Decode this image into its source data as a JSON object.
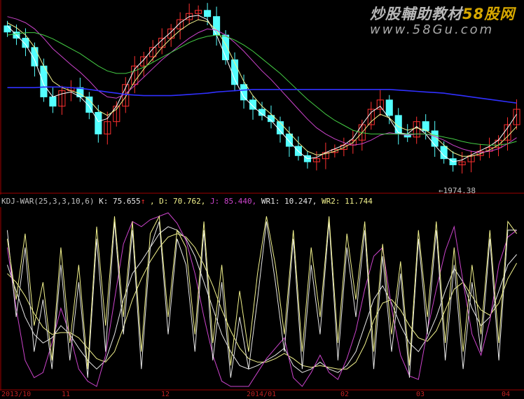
{
  "watermark": {
    "title_a": "炒股輔助教材",
    "title_b": "58股网",
    "url": "www.58Gu.com"
  },
  "price_panel": {
    "low_arrow": "←",
    "low_value": "1974.38"
  },
  "indicator": {
    "name": "KDJ-WAR(25,3,3,10,6)",
    "k_text": " K: 75.655",
    "k_arrow": "↑",
    "d_text": ", D: 70.762,",
    "j_text": " J: 85.440,",
    "wr1_text": " WR1: 10.247,",
    "wr2_text": " WR2: 11.744"
  },
  "colors": {
    "background": "#000000",
    "up_candle": "#ff3030",
    "down_candle": "#54ffff",
    "ma_white": "#ffffff",
    "ma_yellow": "#f2f28c",
    "ma_magenta": "#cc44cc",
    "ma_green": "#44cc44",
    "ma_blue": "#3030ff",
    "k_line": "#e8e8e8",
    "d_line": "#f2f28c",
    "j_line": "#cc44cc",
    "divider": "#a00000"
  },
  "chart_data": [
    {
      "type": "candlestick",
      "panel": "price",
      "low_annotation": 1974.38,
      "closes": [
        2205,
        2195,
        2180,
        2150,
        2100,
        2085,
        2110,
        2115,
        2100,
        2075,
        2040,
        2060,
        2085,
        2120,
        2150,
        2165,
        2180,
        2195,
        2210,
        2225,
        2235,
        2240,
        2230,
        2200,
        2160,
        2120,
        2095,
        2080,
        2070,
        2060,
        2040,
        2020,
        2005,
        1995,
        2000,
        2010,
        2015,
        2022,
        2030,
        2055,
        2080,
        2095,
        2070,
        2040,
        2035,
        2060,
        2045,
        2020,
        2000,
        1990,
        1995,
        2005,
        2012,
        2018,
        2030,
        2055,
        2080
      ],
      "moving_averages": [
        {
          "name": "MA5",
          "color": "#ffffff",
          "values": [
            2215,
            2200,
            2185,
            2160,
            2120,
            2100,
            2105,
            2108,
            2100,
            2085,
            2060,
            2065,
            2085,
            2115,
            2145,
            2160,
            2178,
            2192,
            2205,
            2220,
            2230,
            2232,
            2225,
            2200,
            2165,
            2128,
            2100,
            2085,
            2072,
            2062,
            2045,
            2028,
            2012,
            2000,
            2002,
            2010,
            2016,
            2022,
            2033,
            2055,
            2075,
            2085,
            2065,
            2042,
            2040,
            2052,
            2040,
            2022,
            2005,
            1995,
            1998,
            2006,
            2013,
            2020,
            2030,
            2050,
            2072
          ]
        },
        {
          "name": "MA10",
          "color": "#f2f28c",
          "values": [
            2220,
            2212,
            2200,
            2180,
            2150,
            2125,
            2115,
            2110,
            2105,
            2095,
            2078,
            2070,
            2080,
            2100,
            2125,
            2145,
            2162,
            2180,
            2195,
            2208,
            2218,
            2225,
            2222,
            2208,
            2185,
            2155,
            2125,
            2102,
            2085,
            2072,
            2058,
            2042,
            2026,
            2012,
            2006,
            2008,
            2012,
            2018,
            2026,
            2042,
            2060,
            2072,
            2066,
            2052,
            2046,
            2050,
            2046,
            2036,
            2022,
            2010,
            2004,
            2004,
            2008,
            2014,
            2022,
            2036,
            2052
          ]
        },
        {
          "name": "MA20",
          "color": "#cc44cc",
          "values": [
            2230,
            2226,
            2220,
            2210,
            2195,
            2178,
            2165,
            2152,
            2140,
            2126,
            2110,
            2100,
            2098,
            2105,
            2118,
            2132,
            2146,
            2160,
            2172,
            2184,
            2195,
            2204,
            2210,
            2208,
            2200,
            2188,
            2174,
            2158,
            2142,
            2128,
            2112,
            2096,
            2080,
            2064,
            2050,
            2040,
            2032,
            2026,
            2022,
            2024,
            2030,
            2038,
            2042,
            2040,
            2038,
            2040,
            2040,
            2036,
            2030,
            2022,
            2016,
            2012,
            2010,
            2012,
            2016,
            2024,
            2034
          ]
        },
        {
          "name": "MA30",
          "color": "#44cc44",
          "values": [
            2200,
            2202,
            2204,
            2204,
            2200,
            2194,
            2186,
            2178,
            2170,
            2160,
            2150,
            2142,
            2138,
            2138,
            2142,
            2148,
            2156,
            2164,
            2172,
            2180,
            2188,
            2194,
            2198,
            2200,
            2198,
            2192,
            2184,
            2174,
            2162,
            2150,
            2138,
            2124,
            2110,
            2096,
            2084,
            2072,
            2062,
            2054,
            2046,
            2042,
            2040,
            2040,
            2040,
            2040,
            2040,
            2040,
            2040,
            2038,
            2035,
            2032,
            2028,
            2025,
            2023,
            2022,
            2022,
            2024,
            2028
          ]
        },
        {
          "name": "MA60",
          "color": "#3030ff",
          "values": [
            2115,
            2115,
            2115,
            2115,
            2116,
            2116,
            2116,
            2115,
            2114,
            2112,
            2110,
            2108,
            2106,
            2104,
            2103,
            2102,
            2102,
            2102,
            2102,
            2103,
            2104,
            2105,
            2106,
            2108,
            2109,
            2110,
            2111,
            2112,
            2112,
            2112,
            2112,
            2112,
            2112,
            2112,
            2112,
            2112,
            2112,
            2112,
            2112,
            2112,
            2112,
            2112,
            2112,
            2111,
            2110,
            2109,
            2108,
            2107,
            2106,
            2104,
            2102,
            2100,
            2098,
            2096,
            2094,
            2092,
            2090
          ]
        }
      ]
    },
    {
      "type": "line",
      "panel": "indicator",
      "ylim": [
        0,
        100
      ],
      "series": [
        {
          "name": "K",
          "color": "#e8e8e8",
          "values": [
            70,
            55,
            40,
            30,
            25,
            28,
            35,
            30,
            22,
            15,
            10,
            15,
            30,
            50,
            65,
            72,
            80,
            88,
            92,
            90,
            85,
            75,
            60,
            45,
            30,
            20,
            12,
            10,
            12,
            15,
            18,
            22,
            12,
            8,
            10,
            14,
            10,
            8,
            12,
            20,
            35,
            50,
            58,
            48,
            35,
            25,
            20,
            28,
            40,
            55,
            68,
            60,
            45,
            35,
            40,
            55,
            70,
            76
          ]
        },
        {
          "name": "D",
          "color": "#f2f28c",
          "values": [
            65,
            60,
            52,
            42,
            34,
            30,
            31,
            31,
            28,
            22,
            16,
            14,
            20,
            34,
            50,
            62,
            72,
            80,
            86,
            88,
            86,
            80,
            70,
            58,
            44,
            32,
            22,
            16,
            14,
            14,
            16,
            19,
            16,
            12,
            11,
            12,
            11,
            10,
            10,
            14,
            24,
            38,
            48,
            50,
            44,
            35,
            28,
            26,
            32,
            44,
            56,
            60,
            52,
            44,
            41,
            48,
            62,
            71
          ]
        },
        {
          "name": "J",
          "color": "#cc44cc",
          "values": [
            80,
            45,
            15,
            5,
            8,
            25,
            45,
            30,
            10,
            3,
            0,
            18,
            50,
            82,
            95,
            92,
            96,
            98,
            100,
            94,
            84,
            65,
            40,
            18,
            3,
            0,
            0,
            0,
            8,
            16,
            22,
            28,
            5,
            0,
            8,
            18,
            8,
            4,
            16,
            32,
            56,
            75,
            80,
            45,
            18,
            6,
            4,
            32,
            56,
            78,
            92,
            60,
            30,
            18,
            38,
            70,
            86,
            90
          ]
        },
        {
          "name": "WR1",
          "color": "#e8e8e8",
          "values": [
            90,
            40,
            80,
            20,
            50,
            10,
            70,
            15,
            60,
            5,
            85,
            20,
            95,
            30,
            90,
            10,
            80,
            95,
            30,
            85,
            70,
            20,
            90,
            15,
            60,
            5,
            40,
            10,
            50,
            95,
            60,
            20,
            85,
            10,
            70,
            30,
            95,
            15,
            80,
            40,
            90,
            10,
            75,
            20,
            65,
            5,
            85,
            30,
            90,
            15,
            70,
            10,
            60,
            20,
            85,
            15,
            90,
            90
          ]
        },
        {
          "name": "WR2",
          "color": "#f2f28c",
          "values": [
            85,
            50,
            88,
            35,
            60,
            15,
            80,
            25,
            70,
            10,
            92,
            35,
            98,
            40,
            95,
            20,
            88,
            98,
            40,
            90,
            80,
            30,
            95,
            25,
            70,
            12,
            55,
            20,
            65,
            98,
            70,
            30,
            90,
            20,
            80,
            40,
            98,
            25,
            88,
            50,
            95,
            20,
            82,
            30,
            72,
            12,
            90,
            40,
            95,
            25,
            80,
            20,
            70,
            30,
            90,
            25,
            95,
            88
          ]
        }
      ]
    }
  ],
  "chart_data_note_labels": [],
  "chart_data_x": [],
  "chart_data_labels": [],
  "chart_data_extra": {},
  "chart_data_axis": {},
  "chart_data_meta": {},
  "chart_data_legend": {},
  "chart_data_grid": false,
  "chart_data_type": "candlestick+line",
  "x_axis": {},
  "_": ""
}
